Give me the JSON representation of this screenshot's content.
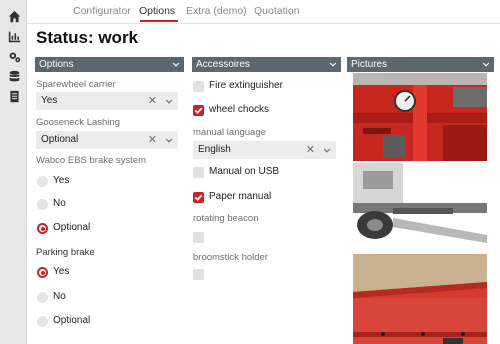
{
  "sidebar": {
    "icons": [
      "home-icon",
      "dashboard-icon",
      "settings-icon",
      "database-icon",
      "document-icon"
    ]
  },
  "tabs": [
    {
      "label": "Configurator",
      "active": false
    },
    {
      "label": "Options",
      "active": true
    },
    {
      "label": "Extra (demo)",
      "active": false
    },
    {
      "label": "Quotation",
      "active": false
    }
  ],
  "page_title": "Status: work",
  "options": {
    "header": "Options",
    "sparewheel": {
      "label": "Sparewheel carrier",
      "value": "Yes"
    },
    "gooseneck": {
      "label": "Gooseneck Lashing",
      "value": "Optional"
    },
    "wabco": {
      "label": "Wabco EBS brake system",
      "options": [
        "Yes",
        "No",
        "Optional"
      ],
      "selected": "Optional"
    },
    "parking": {
      "label": "Parking brake",
      "options": [
        "Yes",
        "No",
        "Optional"
      ],
      "selected": "Yes"
    }
  },
  "accessoires": {
    "header": "Accessoires",
    "fire_extinguisher": {
      "label": "Fire extinguisher",
      "checked": false
    },
    "wheel_chocks": {
      "label": "wheel chocks",
      "checked": true
    },
    "manual_language": {
      "label": "manual language",
      "value": "English"
    },
    "manual_usb": {
      "label": "Manual on USB",
      "checked": false
    },
    "paper_manual": {
      "label": "Paper manual",
      "checked": true
    },
    "rotating_beacon": {
      "label": "rotating beacon",
      "checked": false
    },
    "broomstick_holder": {
      "label": "broomstick holder",
      "checked": false
    }
  },
  "pictures": {
    "header": "Pictures"
  },
  "colors": {
    "accent": "#c8232c",
    "header_bg": "#5b6870",
    "sidebar_bg": "#e7e7e7"
  }
}
